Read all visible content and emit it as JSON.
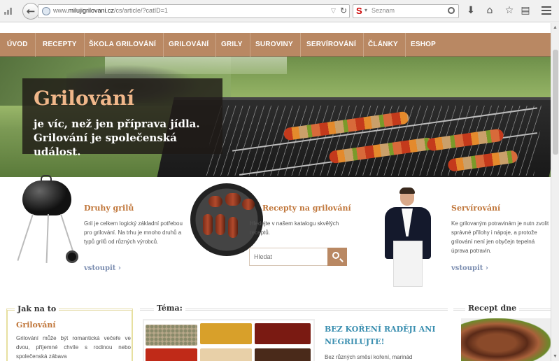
{
  "browser": {
    "url_prefix": "www.",
    "url_domain": "milujigrilovani.cz",
    "url_path": "/cs/article/?catID=1",
    "search_engine": "Seznam",
    "back_icon": "arrow-left-icon",
    "reload_icon": "reload-icon"
  },
  "nav": {
    "items": [
      "Úvod",
      "Recepty",
      "Škola grilování",
      "Grilování",
      "Grily",
      "Suroviny",
      "Servírování",
      "Články",
      "Eshop"
    ]
  },
  "hero": {
    "title": "Grilování",
    "subtitle": "je víc, než jen příprava jídla. Grilování je společenská událost."
  },
  "features": [
    {
      "title": "Druhy grilů",
      "text": "Gril je celkem logický základní potřebou pro grilování. Na trhu je mnoho druhů a typů grilů od různých výrobců.",
      "link": "vstoupit ›"
    },
    {
      "title": "Recepty na grilování",
      "text": "Hledejte v našem katalogu skvělých receptů.",
      "search_placeholder": "Hledat"
    },
    {
      "title": "Servírování",
      "text": "Ke grilovaným potravinám je nutn zvolit správné přílohy i nápoje, a protože grilování není jen obyčejn tepelná úprava potravin.",
      "link": "vstoupit ›"
    }
  ],
  "bottom": {
    "howto_head": "Jak na to",
    "howto_title": "Grilování",
    "howto_text": "Grilování může být romantická večeře ve dvou, příjemné chvíle s rodinou nebo společenská zábava",
    "topic_head": "Téma:",
    "article_title": "Bez koření raději ani negrilujte!",
    "article_text": "Bez různých směsí koření, marinád",
    "recipe_head": "Recept dne"
  },
  "colors": {
    "nav_bg": "#b98863",
    "accent_orange": "#c0763a",
    "link_blue": "#7b8db0",
    "article_blue": "#3b8fb0"
  }
}
